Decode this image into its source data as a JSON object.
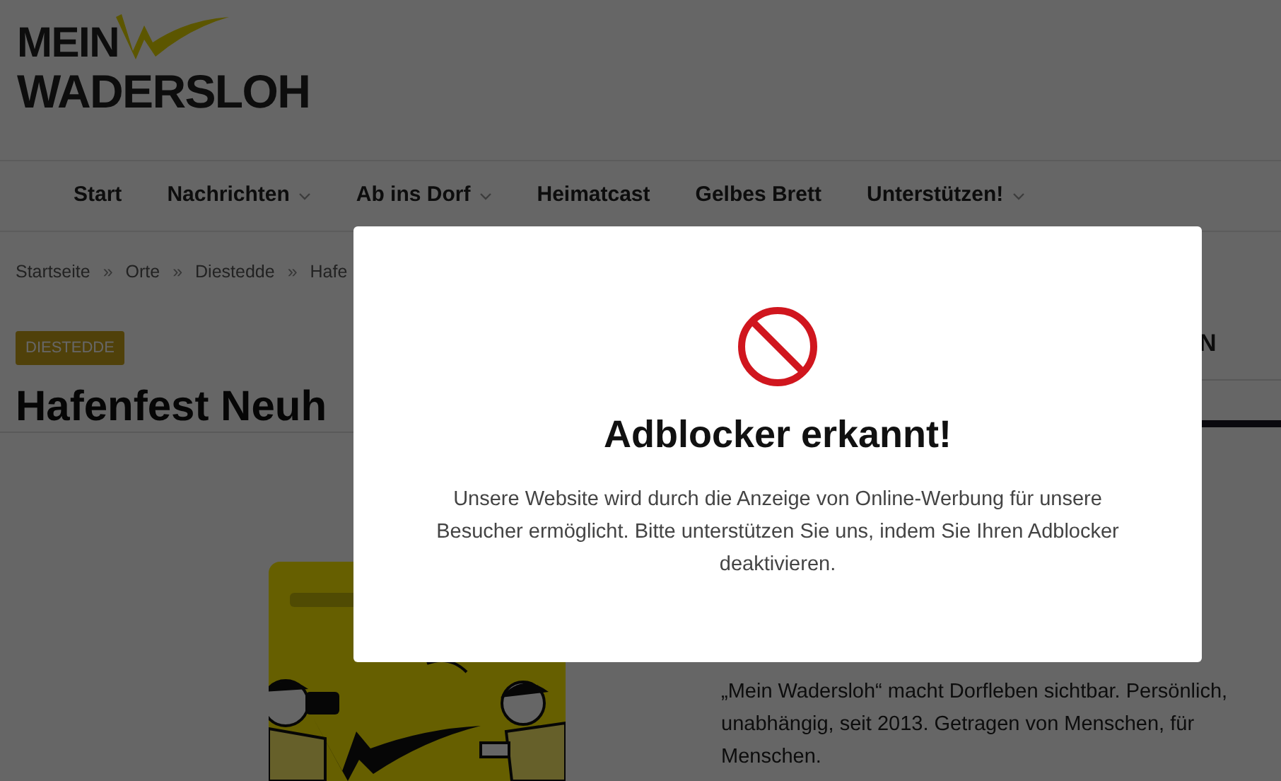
{
  "logo": {
    "line_1": "MEIN",
    "line_2": "WADERSLOH"
  },
  "nav": [
    {
      "label": "Start",
      "has_submenu": false
    },
    {
      "label": "Nachrichten",
      "has_submenu": true
    },
    {
      "label": "Ab ins Dorf",
      "has_submenu": true
    },
    {
      "label": "Heimatcast",
      "has_submenu": false
    },
    {
      "label": "Gelbes Brett",
      "has_submenu": false
    },
    {
      "label": "Unterstützen!",
      "has_submenu": true
    }
  ],
  "breadcrumb": [
    "Startseite",
    "»",
    "Orte",
    "»",
    "Diestedde",
    "»",
    "Hafe"
  ],
  "category_badge": "DIESTEDDE",
  "article_title": "Hafenfest Neuh",
  "sidebar_heading": "N",
  "about_text": "„Mein Wadersloh“ macht Dorfleben sichtbar. Persönlich, unabhängig, seit 2013. Getragen von Menschen, für Menschen.",
  "modal": {
    "title": "Adblocker erkannt!",
    "message": "Unsere Website wird durch die Anzeige von Online-Werbung für unsere Besucher ermöglicht. Bitte unterstützen Sie uns, indem Sie Ihren Adblocker deaktivieren."
  }
}
